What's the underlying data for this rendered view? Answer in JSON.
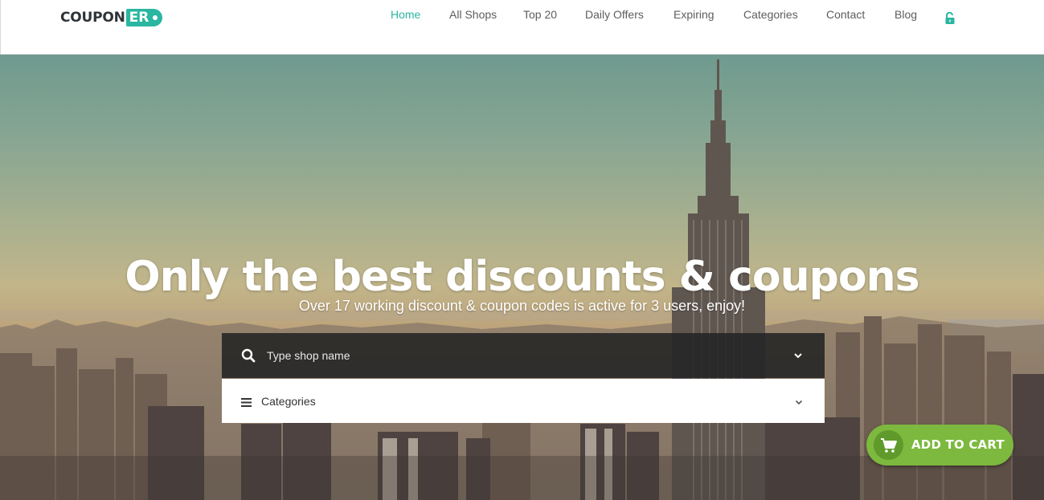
{
  "brand": {
    "logo_text": "COUPON",
    "logo_badge": "ER",
    "accent_color": "#2ab6a1"
  },
  "nav": {
    "items": [
      {
        "label": "Home",
        "active": true
      },
      {
        "label": "All Shops",
        "active": false
      },
      {
        "label": "Top 20",
        "active": false
      },
      {
        "label": "Daily Offers",
        "active": false
      },
      {
        "label": "Expiring",
        "active": false
      },
      {
        "label": "Categories",
        "active": false
      },
      {
        "label": "Contact",
        "active": false
      },
      {
        "label": "Blog",
        "active": false
      }
    ],
    "login_icon": "unlock-icon"
  },
  "hero": {
    "title": "Only the best discounts & coupons",
    "subtitle": "Over 17 working discount & coupon codes is active for 3 users, enjoy!"
  },
  "search": {
    "placeholder": "Type shop name",
    "value": "",
    "icon": "search-icon",
    "dropdown_icon": "chevron-down-icon"
  },
  "categories": {
    "label": "Categories",
    "icon": "list-icon",
    "dropdown_icon": "chevron-down-icon"
  },
  "cart": {
    "label": "ADD TO CART",
    "icon": "cart-icon",
    "color": "#7cb93e"
  }
}
